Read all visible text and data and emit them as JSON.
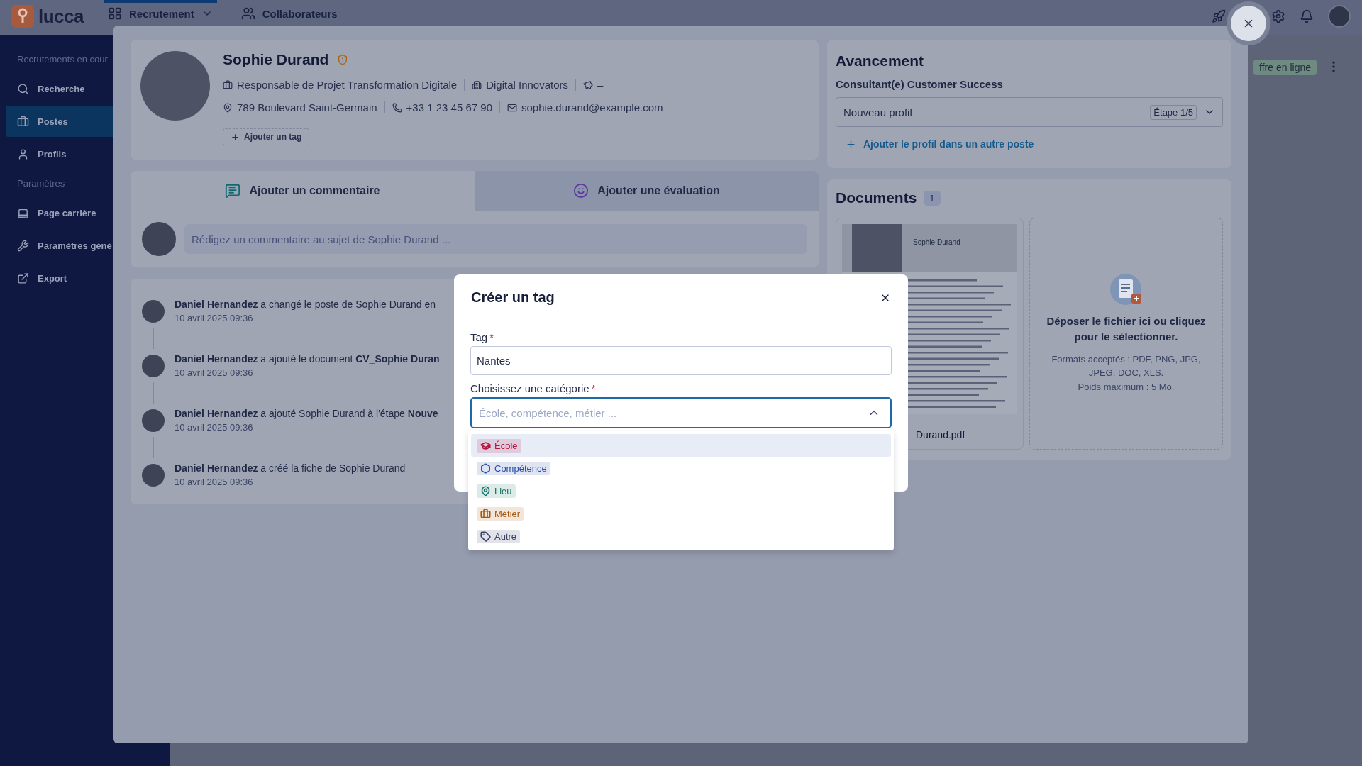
{
  "topbar": {
    "logo": "lucca",
    "nav": [
      {
        "label": "Recrutement",
        "selected": true,
        "has_menu": true
      },
      {
        "label": "Collaborateurs",
        "selected": false,
        "has_menu": false
      }
    ]
  },
  "sidebar": {
    "sections": [
      {
        "title": "Recrutements en cour",
        "items": [
          {
            "label": "Recherche",
            "selected": false
          },
          {
            "label": "Postes",
            "selected": true
          },
          {
            "label": "Profils",
            "selected": false
          }
        ]
      },
      {
        "title": "Paramètres",
        "items": [
          {
            "label": "Page carrière",
            "selected": false
          },
          {
            "label": "Paramètres géné",
            "selected": false
          },
          {
            "label": "Export",
            "selected": false
          }
        ]
      }
    ]
  },
  "background_row": {
    "badge": "ffre en ligne"
  },
  "profile": {
    "name": "Sophie Durand",
    "info_rows": [
      [
        "Responsable de Projet Transformation Digitale",
        "Digital Innovators",
        "–"
      ],
      [
        "789 Boulevard Saint-Germain",
        "+33 1 23 45 67 90",
        "sophie.durand@example.com"
      ]
    ],
    "add_tag": "Ajouter un tag"
  },
  "comment_tabs": [
    {
      "label": "Ajouter un commentaire",
      "selected": true
    },
    {
      "label": "Ajouter une évaluation",
      "selected": false
    }
  ],
  "comment_field": {
    "placeholder": "Rédigez un commentaire au sujet de Sophie Durand ..."
  },
  "timeline": [
    {
      "text": "**Daniel Hernandez** a changé le poste de Sophie Durand en",
      "time": "10 avril 2025 09:36"
    },
    {
      "text": "**Daniel Hernandez** a ajouté le document **CV_Sophie Duran**",
      "time": "10 avril 2025 09:36"
    },
    {
      "text": "**Daniel Hernandez** a ajouté Sophie Durand à l'étape **Nouve**",
      "time": "10 avril 2025 09:36"
    },
    {
      "text": "**Daniel Hernandez** a créé la fiche de Sophie Durand",
      "time": "10 avril 2025 09:36"
    }
  ],
  "progress": {
    "title": "Avancement",
    "job": "Consultant(e) Customer Success",
    "stage": "Nouveau profil",
    "step": "Étape 1/5",
    "add_link": "Ajouter le profil dans un autre poste"
  },
  "documents": {
    "title": "Documents",
    "count": "1",
    "files": [
      {
        "preview_name": "Sophie Durand",
        "filename": "Durand.pdf"
      }
    ],
    "dropzone": {
      "title": "Déposer le fichier ici ou cliquez pour le sélectionner.",
      "formats": "Formats acceptés : PDF, PNG, JPG, JPEG, DOC, XLS.",
      "max_size": "Poids maximum : 5 Mo."
    }
  },
  "dialog": {
    "title": "Créer un tag",
    "fields": [
      {
        "kind": "text",
        "label": "Tag",
        "required_mark": "*",
        "value": "Nantes"
      },
      {
        "kind": "select",
        "label": "Choisissez une catégorie",
        "required_mark": "*",
        "placeholder": "École, compétence, métier ...",
        "open": true
      }
    ],
    "options": [
      {
        "label": "École",
        "color": "#b3163f",
        "selected": true
      },
      {
        "label": "Compétence",
        "color": "#2a4cab",
        "selected": false
      },
      {
        "label": "Lieu",
        "color": "#137366",
        "selected": false
      },
      {
        "label": "Métier",
        "color": "#a8570a",
        "selected": false
      },
      {
        "label": "Autre",
        "color": "#3b4466",
        "selected": false
      }
    ]
  }
}
